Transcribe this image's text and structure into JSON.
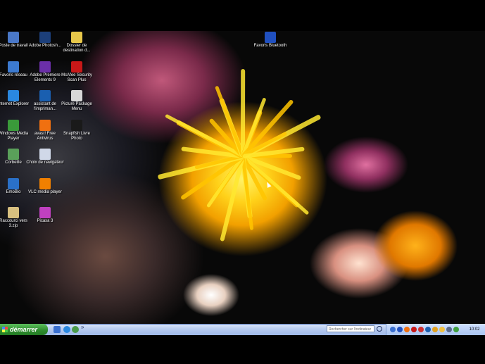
{
  "desktop_icons": [
    {
      "label": "Poste de travail",
      "icon": "computer-icon",
      "color": "#4a78c8"
    },
    {
      "label": "Adobe Photosh...",
      "icon": "photoshop-icon",
      "color": "#1c3f7a"
    },
    {
      "label": "Dossier de destination d...",
      "icon": "folder-icon",
      "color": "#e8c84a"
    },
    {
      "label": "Favoris réseau",
      "icon": "network-icon",
      "color": "#3c7ad0"
    },
    {
      "label": "Adobe Premiere Elements 9",
      "icon": "premiere-icon",
      "color": "#6b2fa8"
    },
    {
      "label": "McAfee Security Scan Plus",
      "icon": "mcafee-icon",
      "color": "#c81818"
    },
    {
      "label": "Internet Explorer",
      "icon": "internet-explorer-icon",
      "color": "#2a88e0"
    },
    {
      "label": "assistant de l'impriman...",
      "icon": "hp-printer-icon",
      "color": "#1a5fb0"
    },
    {
      "label": "Picture Package Menu",
      "icon": "picture-package-icon",
      "color": "#d8d8d8"
    },
    {
      "label": "Windows Media Player",
      "icon": "media-player-icon",
      "color": "#3a9a3a"
    },
    {
      "label": "avast! Free Antivirus",
      "icon": "avast-icon",
      "color": "#f07010"
    },
    {
      "label": "Snapfish Livre Photo",
      "icon": "snapfish-icon",
      "color": "#1a1a1a"
    },
    {
      "label": "Corbeille",
      "icon": "recycle-bin-icon",
      "color": "#5aa05a"
    },
    {
      "label": "Choix de navigateur",
      "icon": "browser-choice-icon",
      "color": "#d0d8e8"
    },
    {
      "label": "EmoBio",
      "icon": "emobio-icon",
      "color": "#2a70c8"
    },
    {
      "label": "VLC media player",
      "icon": "vlc-icon",
      "color": "#f08000"
    },
    {
      "label": "Raccourci vers 3.zip",
      "icon": "zip-shortcut-icon",
      "color": "#d8c080"
    },
    {
      "label": "Picasa 3",
      "icon": "picasa-icon",
      "color": "#c040c0"
    },
    {
      "label": "Favoris Bluetooth",
      "icon": "bluetooth-icon",
      "color": "#2050c0"
    }
  ],
  "taskbar": {
    "start_label": "démarrer",
    "search_placeholder": "Rechercher sur l'ordinateur",
    "clock": "10:02",
    "show_more": "»"
  },
  "colors": {
    "taskbar": "#a9c4f0",
    "start": "#2e8b2e"
  }
}
